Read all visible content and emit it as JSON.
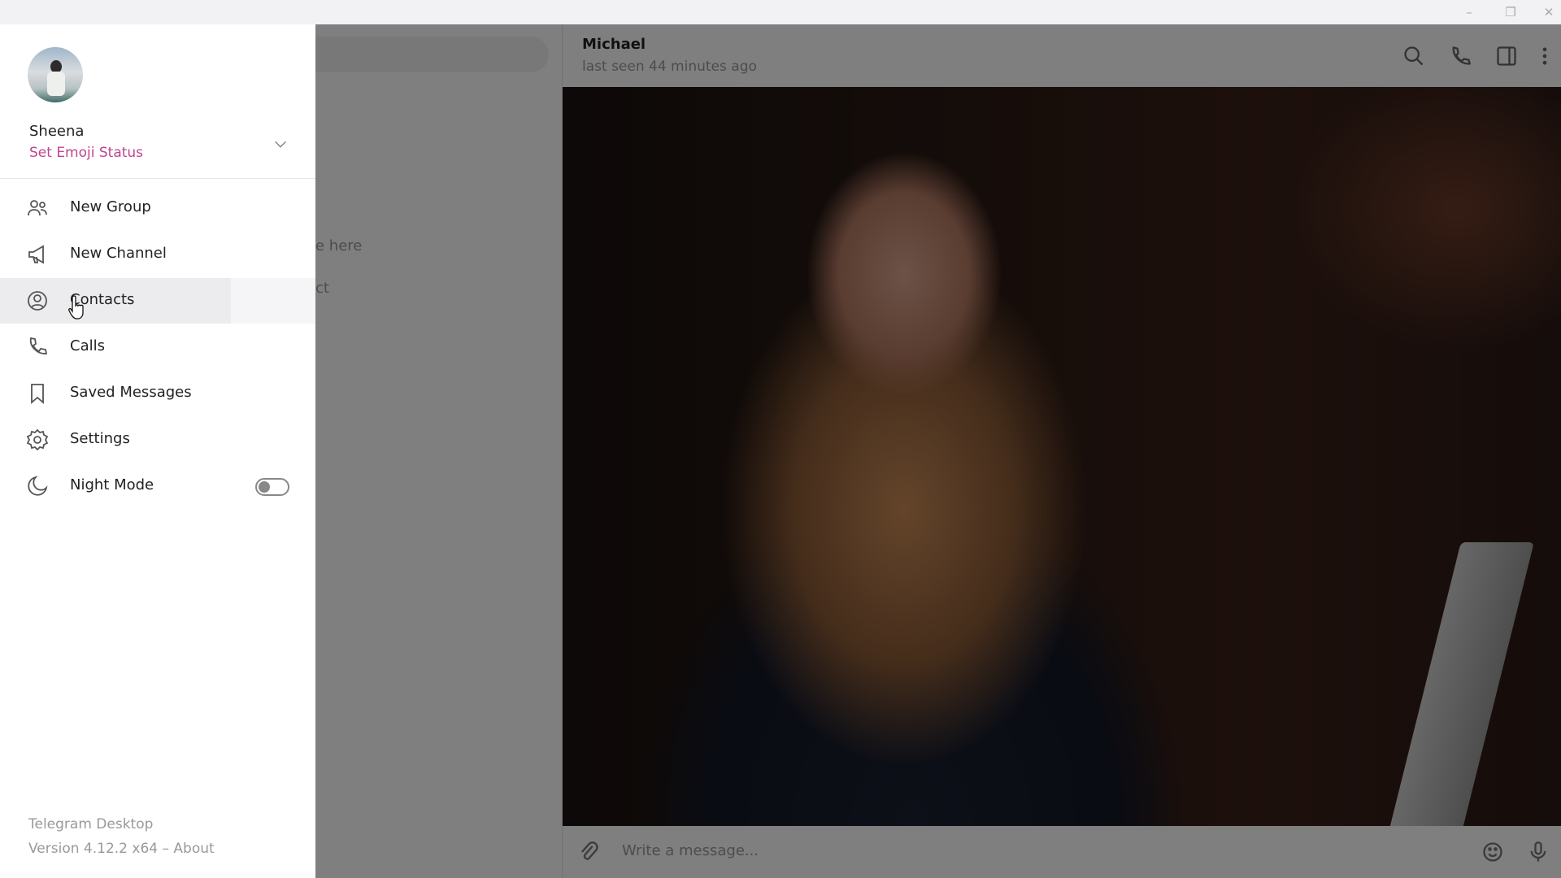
{
  "window": {
    "minimize_icon": "minimize-icon",
    "restore_icon": "restore-icon",
    "close_icon": "close-icon"
  },
  "chatlist": {
    "empty_line1": "e here",
    "empty_line2": "ct"
  },
  "chat": {
    "peer_name": "Michael",
    "peer_status": "last seen 44 minutes ago",
    "input_placeholder": "Write a message..."
  },
  "menu": {
    "user_name": "Sheena",
    "emoji_status": "Set Emoji Status",
    "accent": "#c0458c",
    "items": [
      {
        "label": "New Group",
        "icon": "group-icon"
      },
      {
        "label": "New Channel",
        "icon": "megaphone-icon"
      },
      {
        "label": "Contacts",
        "icon": "contact-icon",
        "hovered": true
      },
      {
        "label": "Calls",
        "icon": "phone-icon"
      },
      {
        "label": "Saved Messages",
        "icon": "bookmark-icon"
      },
      {
        "label": "Settings",
        "icon": "gear-icon"
      },
      {
        "label": "Night Mode",
        "icon": "moon-icon",
        "toggle": false
      }
    ],
    "footer_app": "Telegram Desktop",
    "footer_version": "Version 4.12.2 x64 – About"
  }
}
